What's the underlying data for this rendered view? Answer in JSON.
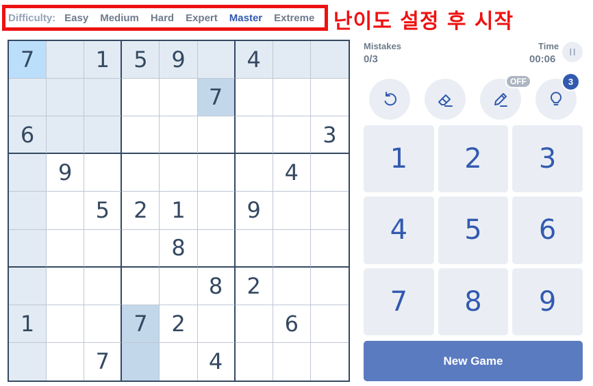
{
  "difficulty": {
    "label": "Difficulty:",
    "options": [
      "Easy",
      "Medium",
      "Hard",
      "Expert",
      "Master",
      "Extreme"
    ],
    "active": "Master"
  },
  "annotation": "난이도 설정 후 시작",
  "board": {
    "cells": [
      "7",
      "",
      "1",
      "5",
      "9",
      "",
      "4",
      "",
      "",
      "",
      "",
      "",
      "",
      "",
      "7",
      "",
      "",
      "",
      "6",
      "",
      "",
      "",
      "",
      "",
      "",
      "",
      "3",
      "",
      "9",
      "",
      "",
      "",
      "",
      "",
      "4",
      "",
      "",
      "",
      "5",
      "2",
      "1",
      "",
      "9",
      "",
      "",
      "",
      "",
      "",
      "",
      "8",
      "",
      "",
      "",
      "",
      "",
      "",
      "",
      "",
      "",
      "8",
      "2",
      "",
      "",
      "1",
      "",
      "",
      "7",
      "2",
      "",
      "",
      "6",
      "",
      "",
      "",
      "7",
      "",
      "",
      "4",
      "",
      "",
      ""
    ],
    "selected_cell": 0,
    "highlighted_cells": [
      1,
      2,
      3,
      4,
      5,
      6,
      7,
      8,
      9,
      10,
      11,
      18,
      19,
      20,
      27,
      36,
      45,
      54,
      63,
      72
    ],
    "same_value_cells": [
      14,
      66,
      75
    ]
  },
  "stats": {
    "mistakes_label": "Mistakes",
    "mistakes_value": "0/3",
    "time_label": "Time",
    "time_value": "00:06"
  },
  "tools": {
    "notes_badge": "OFF",
    "hint_count": "3"
  },
  "numpad": [
    "1",
    "2",
    "3",
    "4",
    "5",
    "6",
    "7",
    "8",
    "9"
  ],
  "new_game_label": "New Game",
  "colors": {
    "accent": "#325aaf",
    "button_bg": "#eaeef4",
    "new_game_bg": "#5a7bc0",
    "selected_cell": "#bbdefb",
    "highlight": "#e2ebf3",
    "same_value": "#c3d7ea",
    "annotation_red": "#ee1111"
  }
}
